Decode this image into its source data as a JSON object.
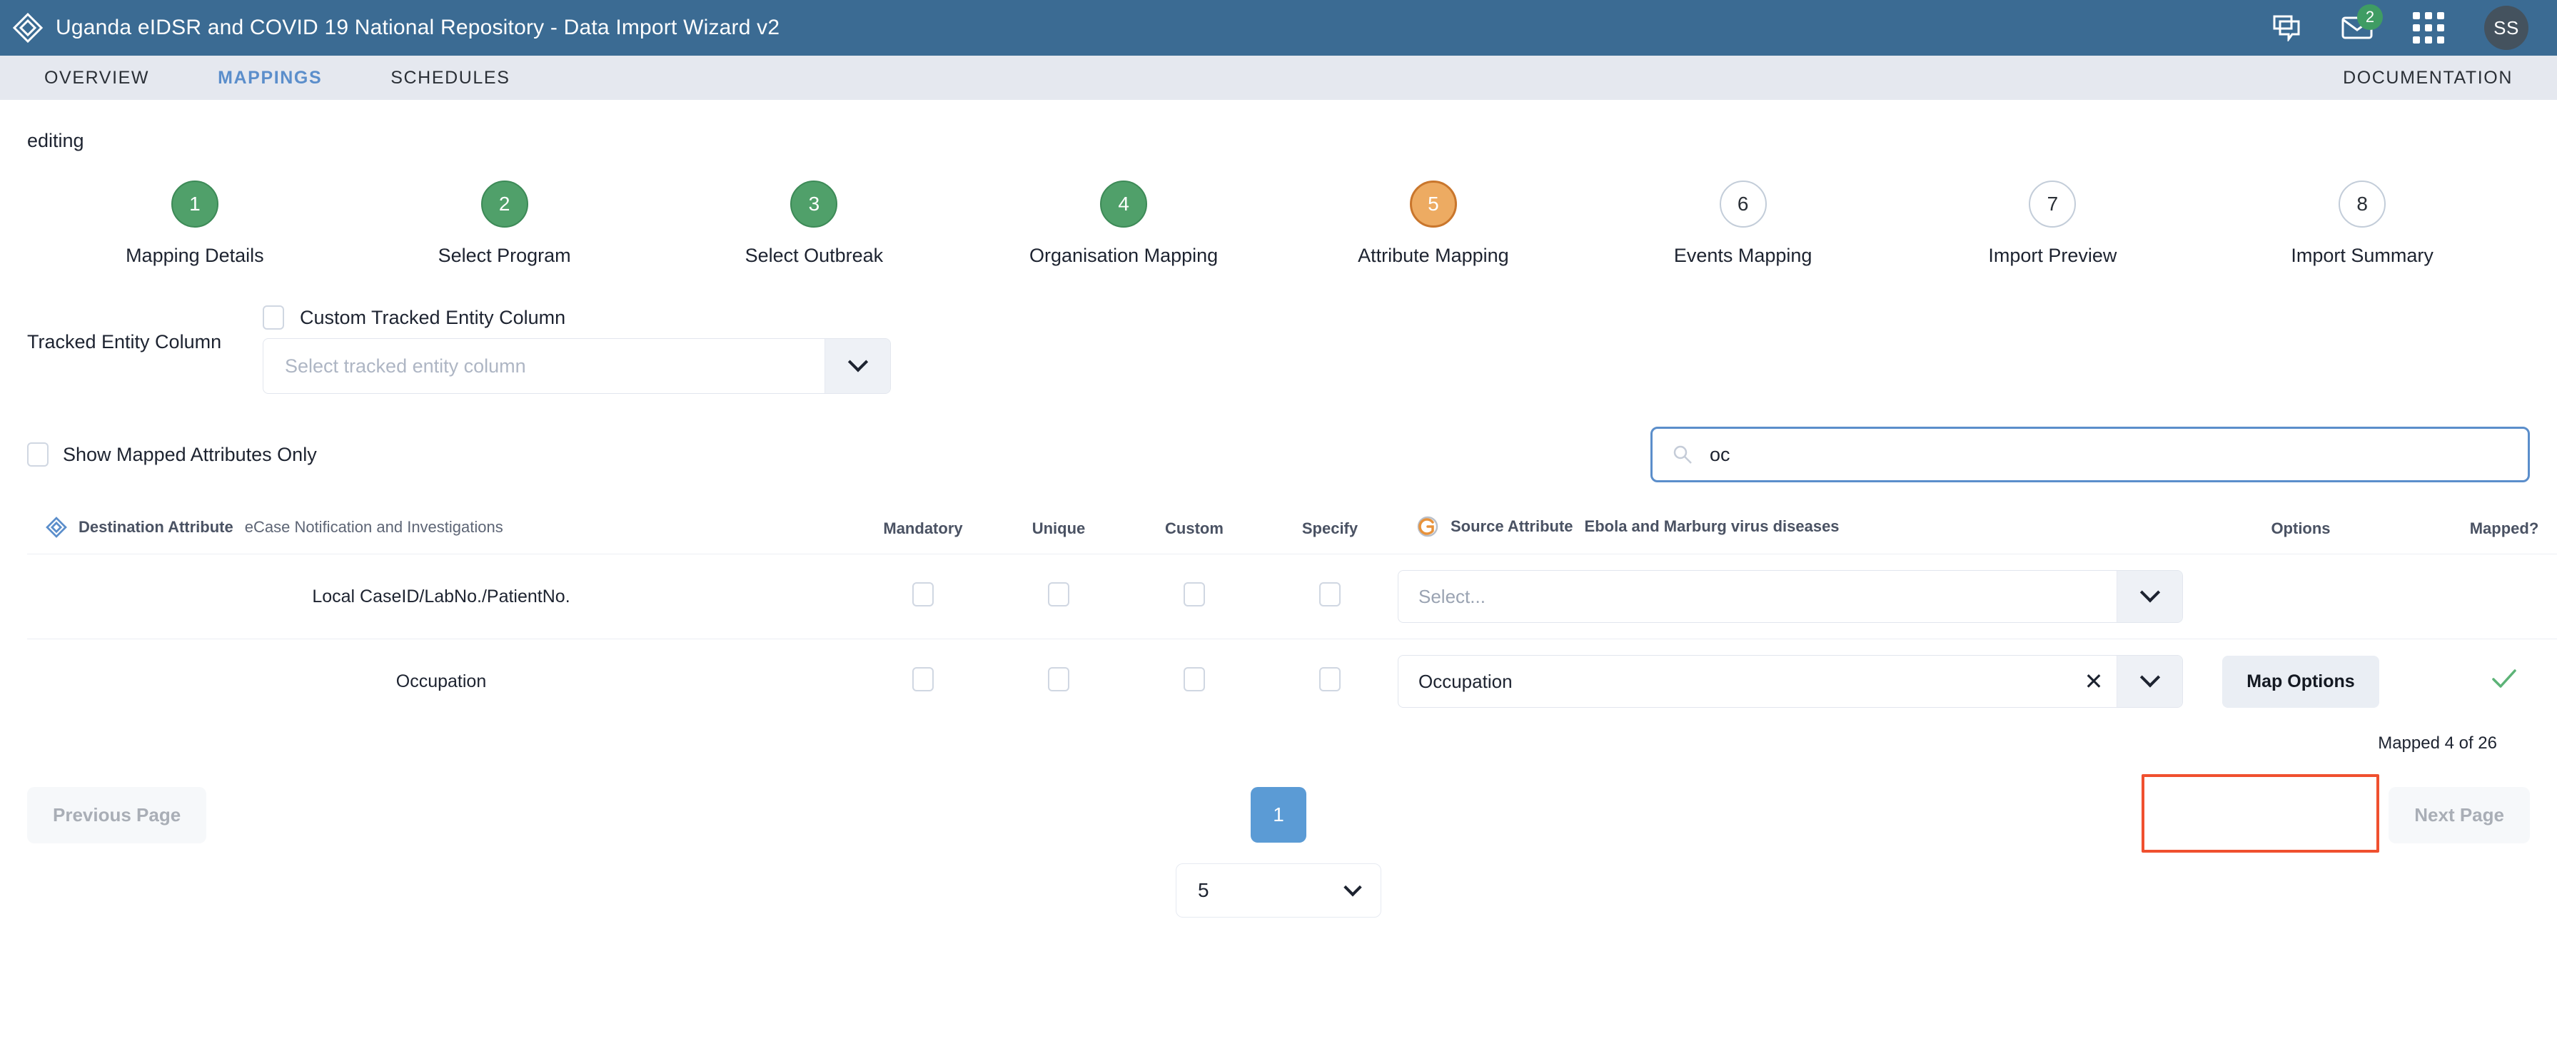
{
  "appbar": {
    "title": "Uganda eIDSR and COVID 19 National Repository - Data Import Wizard v2",
    "logo_icon": "diamond-layers-icon",
    "chat_icon": "chat-bubbles-icon",
    "mail_icon": "envelope-icon",
    "mail_badge": "2",
    "apps_icon": "apps-grid-icon",
    "avatar_initials": "SS"
  },
  "nav": {
    "tabs": [
      {
        "label": "OVERVIEW",
        "active": false
      },
      {
        "label": "MAPPINGS",
        "active": true
      },
      {
        "label": "SCHEDULES",
        "active": false
      }
    ],
    "documentation": "DOCUMENTATION"
  },
  "page": {
    "editing_label": "editing"
  },
  "stepper": {
    "steps": [
      {
        "num": "1",
        "label": "Mapping Details",
        "state": "done"
      },
      {
        "num": "2",
        "label": "Select Program",
        "state": "done"
      },
      {
        "num": "3",
        "label": "Select Outbreak",
        "state": "done"
      },
      {
        "num": "4",
        "label": "Organisation Mapping",
        "state": "done"
      },
      {
        "num": "5",
        "label": "Attribute Mapping",
        "state": "active"
      },
      {
        "num": "6",
        "label": "Events Mapping",
        "state": "todo"
      },
      {
        "num": "7",
        "label": "Import Preview",
        "state": "todo"
      },
      {
        "num": "8",
        "label": "Import Summary",
        "state": "todo"
      }
    ],
    "colors": {
      "done": "#50a06a",
      "active": "#edab62",
      "todo": "#ffffff"
    }
  },
  "tracked_entity": {
    "label": "Tracked Entity Column",
    "custom_checkbox_label": "Custom Tracked Entity Column",
    "custom_checked": false,
    "select_placeholder": "Select tracked entity column",
    "select_value": ""
  },
  "filters": {
    "show_mapped_only_label": "Show Mapped Attributes Only",
    "show_mapped_only_checked": false,
    "search_icon": "search-icon",
    "search_value": "oc",
    "search_focus_color": "#5b8ecb"
  },
  "table": {
    "headers": {
      "destination_attribute": "Destination Attribute",
      "destination_program": "eCase Notification and Investigations",
      "destination_icon": "diamond-layers-icon",
      "mandatory": "Mandatory",
      "unique": "Unique",
      "custom": "Custom",
      "specify": "Specify",
      "source_attribute": "Source Attribute",
      "source_program": "Ebola and Marburg virus diseases",
      "source_icon": "go-data-icon",
      "options": "Options",
      "mapped": "Mapped?"
    },
    "rows": [
      {
        "destination": "Local CaseID/LabNo./PatientNo.",
        "mandatory": false,
        "unique": false,
        "custom": false,
        "specify": false,
        "source_value": "",
        "source_placeholder": "Select...",
        "has_clear": false,
        "options_button": "",
        "mapped": false
      },
      {
        "destination": "Occupation",
        "mandatory": false,
        "unique": false,
        "custom": false,
        "specify": false,
        "source_value": "Occupation",
        "source_placeholder": "",
        "has_clear": true,
        "options_button": "Map Options",
        "mapped": true
      }
    ],
    "mapped_count": "Mapped 4 of 26"
  },
  "pagination": {
    "previous_label": "Previous Page",
    "next_label": "Next Page",
    "current_page": "1",
    "rows_per_page": "5",
    "previous_disabled": true,
    "next_disabled": true
  },
  "annotation": {
    "color": "#f0502f",
    "target": "map-options-button"
  }
}
